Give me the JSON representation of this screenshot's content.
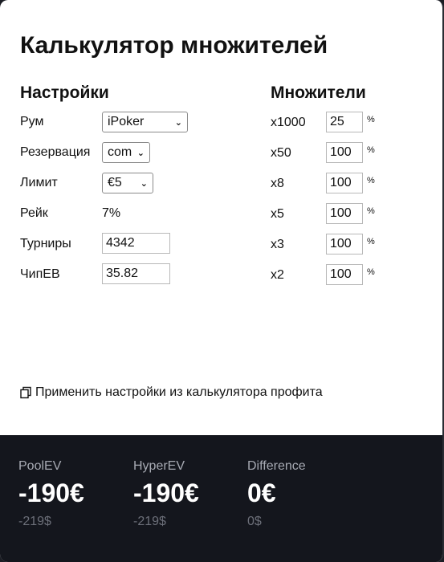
{
  "title": "Калькулятор множителей",
  "settings": {
    "heading": "Настройки",
    "room": {
      "label": "Рум",
      "value": "iPoker"
    },
    "reservation": {
      "label": "Резервация",
      "value": "com"
    },
    "limit": {
      "label": "Лимит",
      "value": "€5"
    },
    "rake": {
      "label": "Рейк",
      "value": "7%"
    },
    "tournaments": {
      "label": "Турниры",
      "value": "4342"
    },
    "chipev": {
      "label": "ЧипЕВ",
      "value": "35.82"
    }
  },
  "multipliers": {
    "heading": "Множители",
    "percent_sign": "%",
    "items": [
      {
        "label": "x1000",
        "value": "25"
      },
      {
        "label": "x50",
        "value": "100"
      },
      {
        "label": "x8",
        "value": "100"
      },
      {
        "label": "x5",
        "value": "100"
      },
      {
        "label": "x3",
        "value": "100"
      },
      {
        "label": "x2",
        "value": "100"
      }
    ]
  },
  "apply_link": "Применить настройки из калькулятора профита",
  "results": [
    {
      "label": "PoolEV",
      "value": "-190€",
      "sub": "-219$"
    },
    {
      "label": "HyperEV",
      "value": "-190€",
      "sub": "-219$"
    },
    {
      "label": "Difference",
      "value": "0€",
      "sub": "0$"
    }
  ]
}
